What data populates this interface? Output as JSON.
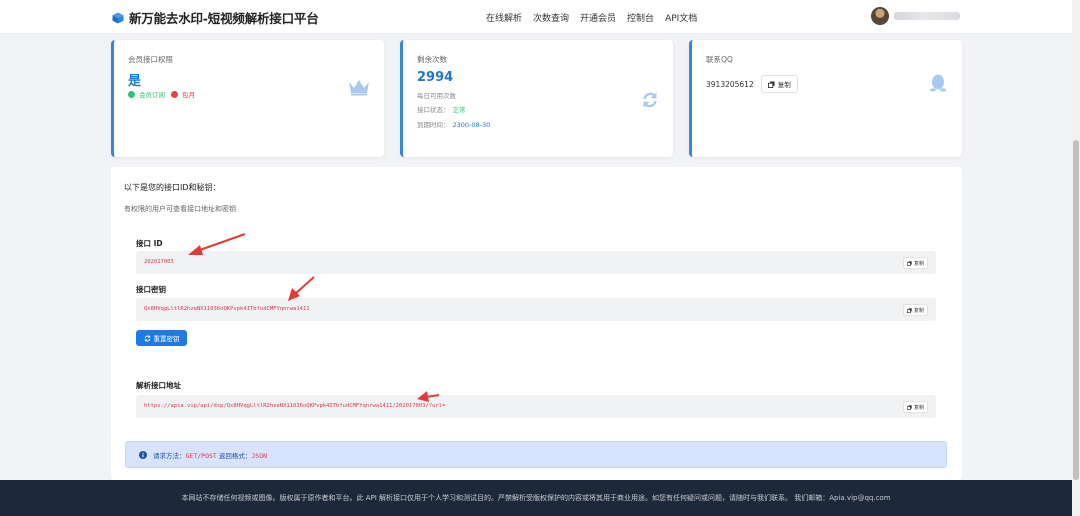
{
  "header": {
    "title": "新万能去水印-短视频解析接口平台",
    "nav": [
      "在线解析",
      "次数查询",
      "开通会员",
      "控制台",
      "API文档"
    ]
  },
  "cards": {
    "membership": {
      "title": "会员接口权限",
      "value": "是",
      "tag1": "会员订阅",
      "tag2": "包月"
    },
    "remaining": {
      "title": "剩余次数",
      "value": "2994",
      "daily": "每日可用次数",
      "status_label": "接口状态：",
      "status_value": "正常",
      "expiry_label": "到期时间：",
      "expiry_value": "2300-08-30"
    },
    "contact": {
      "title": "联系QQ",
      "qq": "3913205612",
      "copy": "复制"
    }
  },
  "panel": {
    "title": "以下是您的接口ID和秘钥：",
    "subtitle": "有权限的用户可查看接口地址和密钥",
    "id_label": "接口 ID",
    "id_value": "202017003",
    "key_label": "接口密钥",
    "key_value": "Qx8HVqgLltlR2hzeNX11036oQKPvpk4ITbfudCMFYqnrwa1411",
    "reset_label": "重置密钥",
    "url_label": "解析接口地址",
    "url_value": "https://apia.vip/api/dsp/Qx8HVqgLltlR2hzeNX11036oQKPvpk4ITbfudCMFYqnrwa1411/202017003/?url=",
    "copy": "复制",
    "info_method_label": "请求方法：",
    "info_method_value": "GET/POST",
    "info_format_label": " 返回格式：",
    "info_format_value": "JSON"
  },
  "footer": {
    "text": "本网站不存储任何视频或图像。版权属于原作者和平台。此 API 解析接口仅用于个人学习和测试目的。严禁解析受版权保护的内容或将其用于商业用途。如您有任何疑问或问题，请随时与我们联系。 我们邮箱：Apia.vip@qq.com"
  },
  "colors": {
    "accent": "#3a86d6",
    "primary_button": "#1e7be6",
    "annotation_arrow": "#e53935",
    "footer_bg": "#1d2838"
  }
}
